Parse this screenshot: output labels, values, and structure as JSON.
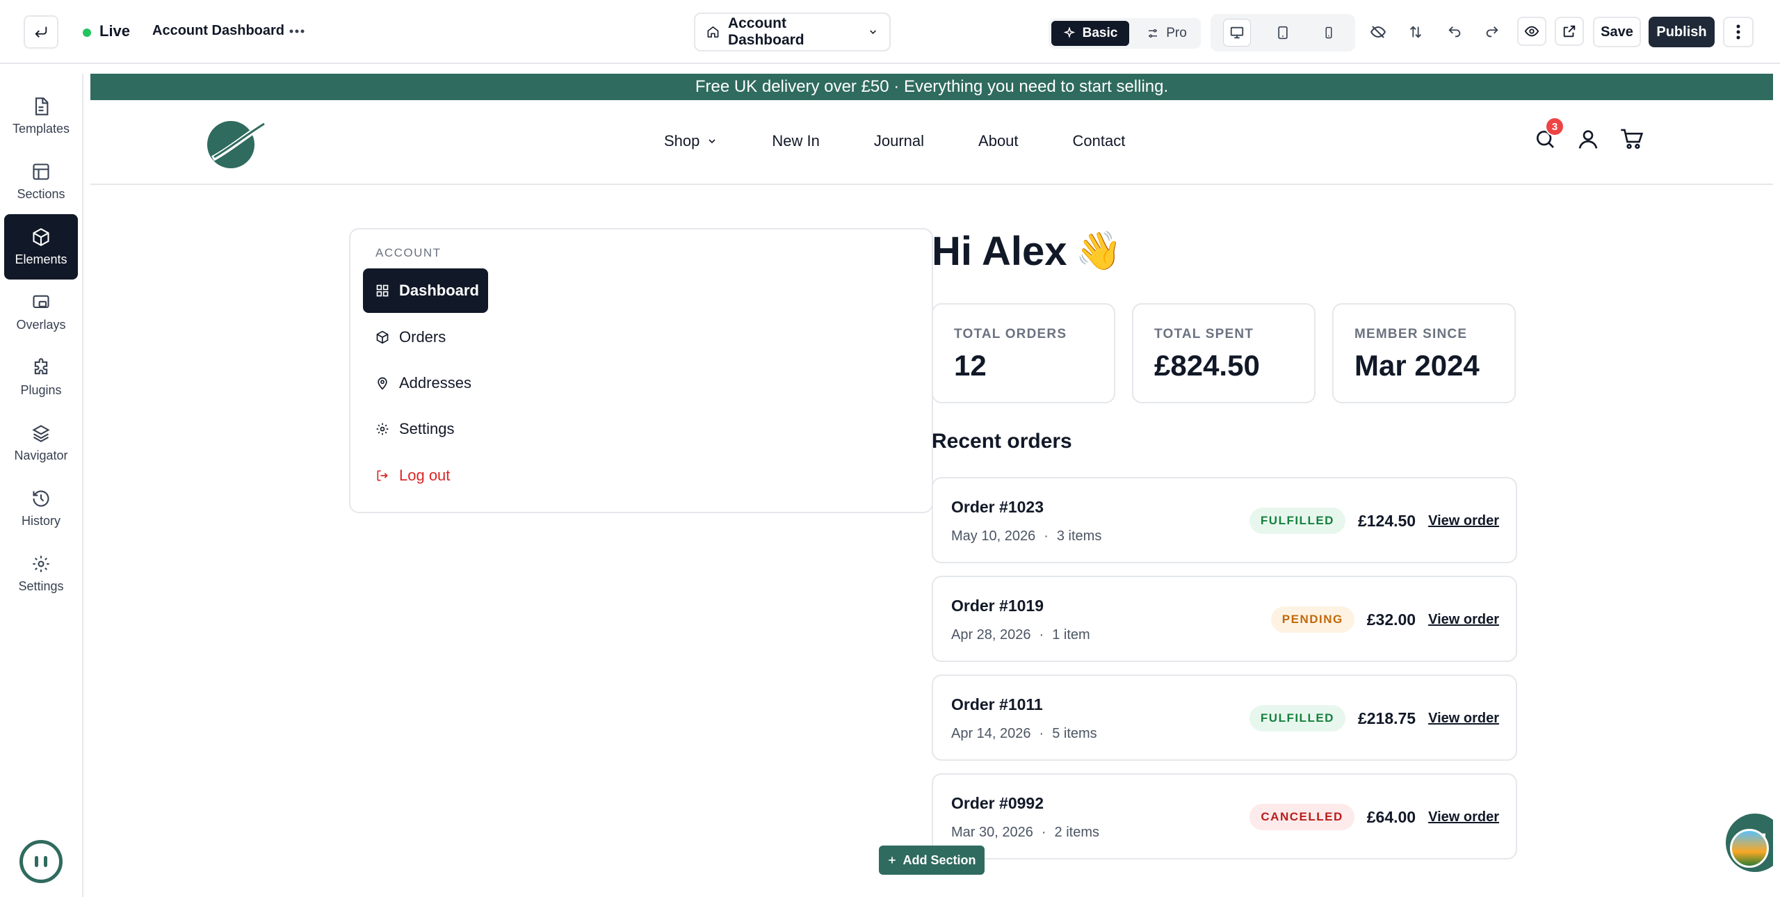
{
  "topbar": {
    "status": "Live",
    "page_name": "Account Dashboard",
    "page_select": "Account Dashboard",
    "mode_basic": "Basic",
    "mode_pro": "Pro",
    "save": "Save",
    "publish": "Publish"
  },
  "sidebar": {
    "items": [
      {
        "label": "Templates",
        "icon": "file-icon"
      },
      {
        "label": "Sections",
        "icon": "layout-icon"
      },
      {
        "label": "Elements",
        "icon": "cube-icon"
      },
      {
        "label": "Overlays",
        "icon": "overlay-icon"
      },
      {
        "label": "Plugins",
        "icon": "puzzle-icon"
      },
      {
        "label": "Navigator",
        "icon": "layers-icon"
      },
      {
        "label": "History",
        "icon": "history-icon"
      },
      {
        "label": "Settings",
        "icon": "gear-icon"
      }
    ],
    "active": "Elements"
  },
  "site": {
    "announcement": "Free UK delivery over £50 · Everything you need to start selling.",
    "nav": [
      "Shop",
      "New In",
      "Journal",
      "About",
      "Contact"
    ],
    "cart_count": "3"
  },
  "account": {
    "eyebrow": "ACCOUNT",
    "nav": [
      "Dashboard",
      "Orders",
      "Addresses",
      "Settings",
      "Log out"
    ],
    "greeting": "Hi Alex",
    "greeting_emoji": "👋"
  },
  "stats": [
    {
      "label": "TOTAL ORDERS",
      "value": "12"
    },
    {
      "label": "TOTAL SPENT",
      "value": "£824.50"
    },
    {
      "label": "MEMBER SINCE",
      "value": "Mar 2024"
    }
  ],
  "recent_title": "Recent orders",
  "orders": [
    {
      "id": "Order #1023",
      "date": "May 10, 2026",
      "items": "3 items",
      "status": "FULFILLED",
      "amount": "£124.50",
      "link": "View order"
    },
    {
      "id": "Order #1019",
      "date": "Apr 28, 2026",
      "items": "1 item",
      "status": "PENDING",
      "amount": "£32.00",
      "link": "View order"
    },
    {
      "id": "Order #1011",
      "date": "Apr 14, 2026",
      "items": "5 items",
      "status": "FULFILLED",
      "amount": "£218.75",
      "link": "View order"
    },
    {
      "id": "Order #0992",
      "date": "Mar 30, 2026",
      "items": "2 items",
      "status": "CANCELLED",
      "amount": "£64.00",
      "link": "View order"
    }
  ],
  "add_section": "Add Section",
  "colors": {
    "brand": "#2f6b5e",
    "dark": "#111827",
    "danger": "#dc2626"
  }
}
